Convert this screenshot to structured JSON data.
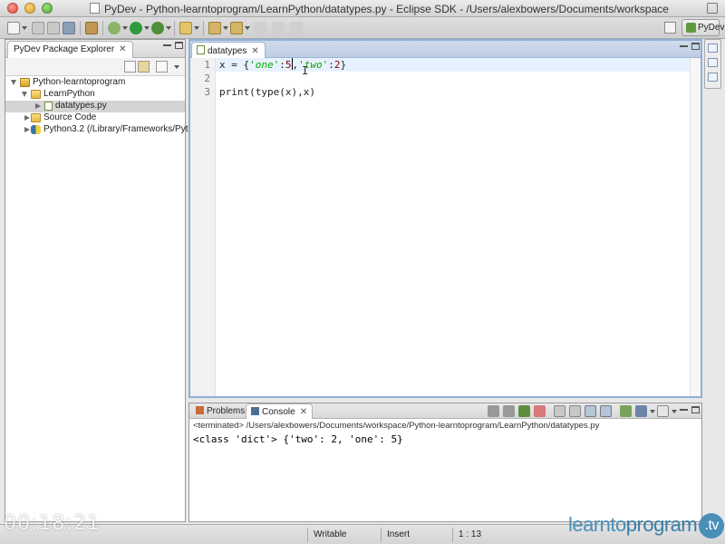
{
  "window": {
    "title": "PyDev - Python-learntoprogram/LearnPython/datatypes.py - Eclipse SDK - /Users/alexbowers/Documents/workspace"
  },
  "perspective": {
    "label": "PyDev"
  },
  "explorer": {
    "tab_label": "PyDev Package Explorer",
    "tree": {
      "project": "Python-learntoprogram",
      "folder": "LearnPython",
      "file": "datatypes.py",
      "source_code": "Source Code",
      "interpreter": "Python3.2  (/Library/Frameworks/Pyt"
    }
  },
  "editor": {
    "tab_label": "datatypes",
    "line_numbers": [
      "1",
      "2",
      "3"
    ],
    "line1": {
      "prefix": "x = {",
      "str1": "'one'",
      "sep1": ":",
      "num1": "5",
      "sep2": ",",
      "str2": "'two'",
      "sep3": ":",
      "num2": "2",
      "suffix": "}"
    },
    "line3": "print(type(x),x)"
  },
  "console": {
    "tabs": [
      "Problems",
      "Console"
    ],
    "info": "<terminated> /Users/alexbowers/Documents/workspace/Python-learntoprogram/LearnPython/datatypes.py",
    "output": "<class 'dict'> {'two': 2, 'one': 5}"
  },
  "status": {
    "writable": "Writable",
    "insert": "Insert",
    "position": "1 : 13"
  },
  "overlay": {
    "timestamp": "00:18:21",
    "brand_main": "learnto",
    "brand_program": "program",
    "brand_tv": ".tv"
  },
  "colors": {
    "string": "#00aa00",
    "number": "#800000",
    "current_line": "#e8f2fe",
    "editor_border": "#8fb0d6"
  },
  "icons": {
    "project": "python-project-icon",
    "folder": "folder-icon",
    "file": "python-file-icon",
    "interpreter": "python-interpreter-icon"
  }
}
